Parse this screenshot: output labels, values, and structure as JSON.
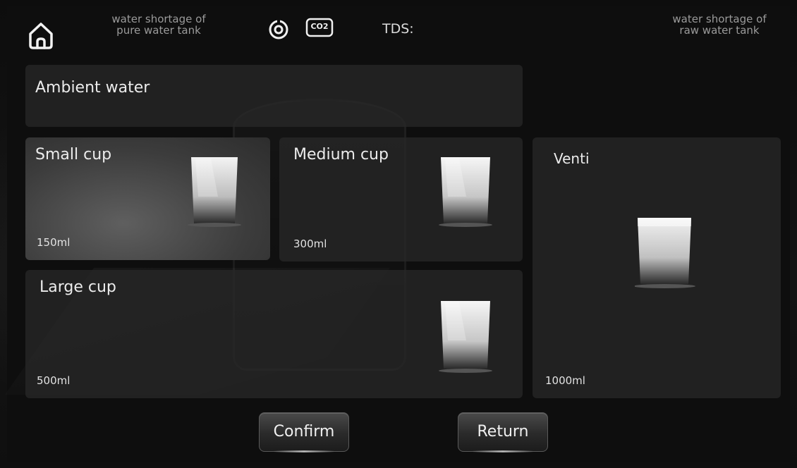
{
  "header": {
    "pure_tank_warning": "water shortage of\npure water tank",
    "raw_tank_warning": "water shortage of\nraw water tank",
    "tds_label": "TDS:",
    "icons": [
      "home-icon",
      "target-icon",
      "co2-icon"
    ],
    "co2_text": "CO2"
  },
  "water_type": {
    "label": "Ambient water"
  },
  "cups": [
    {
      "label": "Small cup",
      "volume": "150ml",
      "selected": true
    },
    {
      "label": "Medium cup",
      "volume": "300ml",
      "selected": false
    },
    {
      "label": "Large cup",
      "volume": "500ml",
      "selected": false
    },
    {
      "label": "Venti",
      "volume": "1000ml",
      "selected": false
    }
  ],
  "buttons": {
    "confirm": "Confirm",
    "return": "Return"
  },
  "colors": {
    "background": "#0b0b0b",
    "panel": "#2a2a2a",
    "selected_panel": "#5f5f5f",
    "text": "#ececec",
    "muted_text": "#9a9a9a"
  }
}
